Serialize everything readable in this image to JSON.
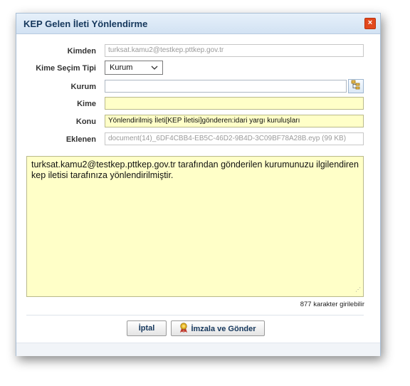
{
  "dialog": {
    "title": "KEP Gelen İleti Yönlendirme",
    "close_glyph": "×"
  },
  "form": {
    "kimden": {
      "label": "Kimden",
      "value": "turksat.kamu2@testkep.pttkep.gov.tr"
    },
    "kime_secim_tipi": {
      "label": "Kime Seçim Tipi",
      "value": "Kurum"
    },
    "kurum": {
      "label": "Kurum",
      "value": ""
    },
    "kime": {
      "label": "Kime",
      "value": ""
    },
    "konu": {
      "label": "Konu",
      "value": "Yönlendirilmiş İleti[KEP İletisi]gönderen:idari yargı kuruluşları"
    },
    "eklenen": {
      "label": "Eklenen",
      "value": "document(14)_6DF4CBB4-EB5C-46D2-9B4D-3C09BF78A28B.eyp (99 KB)"
    }
  },
  "message": {
    "body": "turksat.kamu2@testkep.pttkep.gov.tr tarafından gönderilen kurumunuzu ilgilendiren kep iletisi tarafınıza yönlendirilmiştir.",
    "counter": "877 karakter girilebilir"
  },
  "buttons": {
    "cancel": "İptal",
    "sign_send": "İmzala ve Gönder"
  },
  "icons": {
    "close": "close-icon",
    "picker": "tree-picker-icon",
    "sign": "ribbon-award-icon"
  },
  "colors": {
    "title_text": "#15375c",
    "field_yellow": "#ffffc8",
    "close_red": "#e2481d"
  }
}
